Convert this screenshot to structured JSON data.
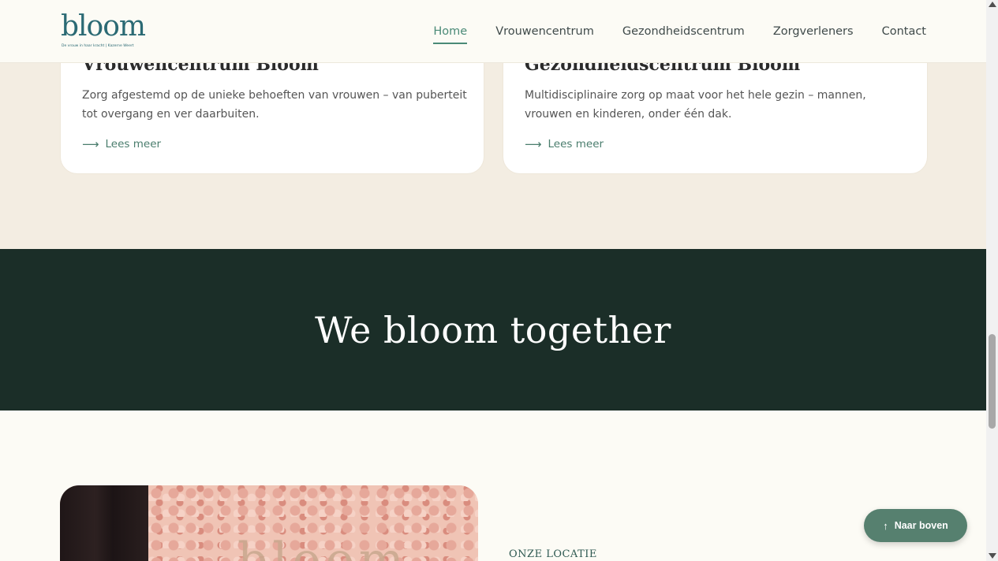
{
  "header": {
    "logo": {
      "word": "bloom",
      "tagline": "De vrouw in haar kracht | Kazerne Weert"
    },
    "nav": [
      {
        "label": "Home",
        "active": true
      },
      {
        "label": "Vrouwencentrum",
        "active": false
      },
      {
        "label": "Gezondheidscentrum",
        "active": false
      },
      {
        "label": "Zorgverleners",
        "active": false
      },
      {
        "label": "Contact",
        "active": false
      }
    ]
  },
  "cards": [
    {
      "title": "Vrouwencentrum Bloom",
      "description": "Zorg afgestemd op de unieke behoeften van vrouwen – van puberteit tot overgang en ver daarbuiten.",
      "link_label": "Lees meer",
      "link_icon": "arrow-right-icon"
    },
    {
      "title": "Gezondheidscentrum Bloom",
      "description": "Multidisciplinaire zorg op maat voor het hele gezin – mannen, vrouwen en kinderen, onder één dak.",
      "link_label": "Lees meer",
      "link_icon": "arrow-right-icon"
    }
  ],
  "banner": {
    "title": "We bloom together"
  },
  "location": {
    "label": "ONZE LOCATIE",
    "image_wordmark": "bloom"
  },
  "back_to_top": {
    "label": "Naar boven",
    "icon": "arrow-up-icon"
  },
  "colors": {
    "accent": "#4a8a77",
    "banner_bg": "#1b2e28",
    "section_bg": "#f3ede2",
    "page_bg": "#fcfbf5",
    "button_bg": "#56806f"
  }
}
